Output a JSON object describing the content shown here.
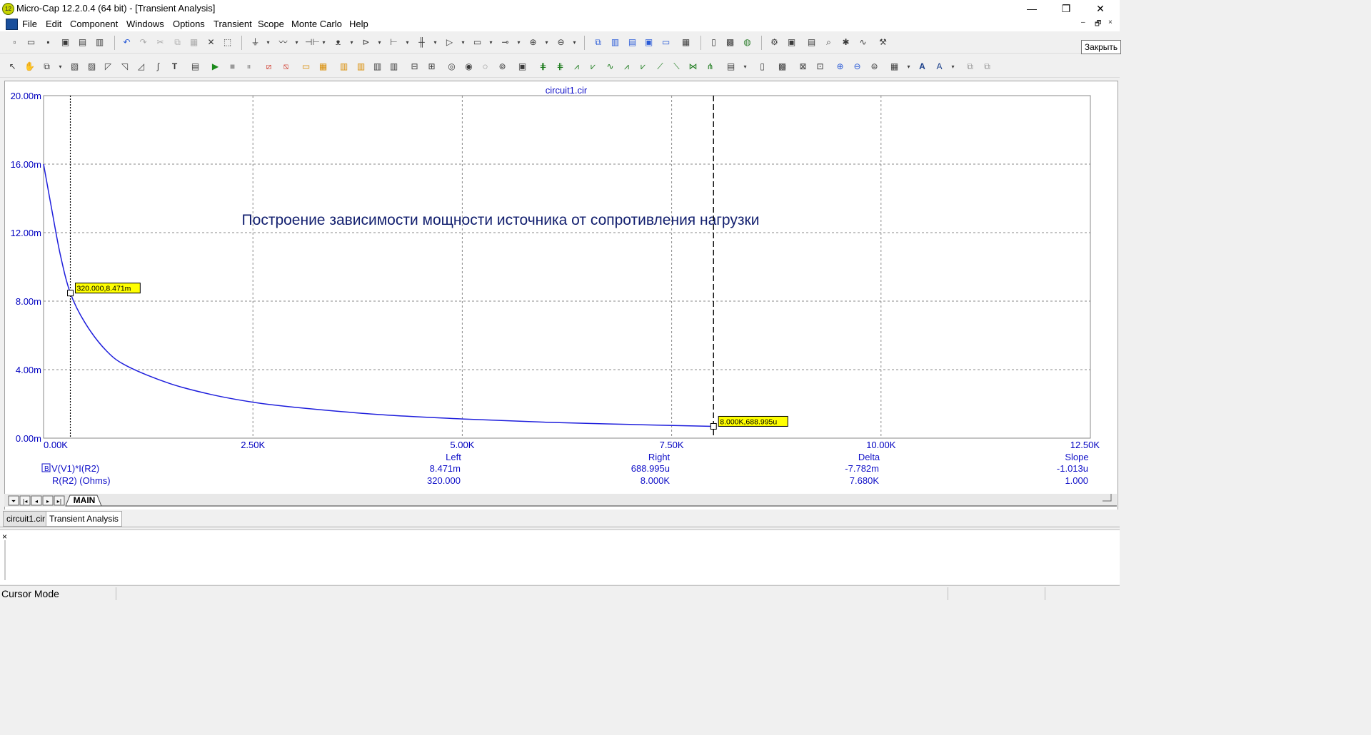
{
  "window": {
    "title": "Micro-Cap 12.2.0.4 (64 bit) - [Transient Analysis]",
    "controls": {
      "minimize": "—",
      "restore": "❐",
      "close": "✕"
    }
  },
  "menu": {
    "items": [
      "File",
      "Edit",
      "Component",
      "Windows",
      "Options",
      "Transient",
      "Scope",
      "Monte Carlo",
      "Help"
    ],
    "mdi": {
      "minimize": "–",
      "restore": "🗗",
      "close": "×"
    }
  },
  "tooltip": "Закрыть",
  "plot": {
    "title": "circuit1.cir",
    "annotation": "Построение зависимости мощности источника от сопротивления нагрузки",
    "curve_color": "#1e1edc",
    "axis_color": "#0000c0",
    "cursor_left_label": "320.000,8.471m",
    "cursor_right_label": "8.000K,688.995u",
    "readout": {
      "headers": [
        "Left",
        "Right",
        "Delta",
        "Slope"
      ],
      "rows": [
        {
          "name": "V(V1)*I(R2)",
          "values": [
            "8.471m",
            "688.995u",
            "-7.782m",
            "-1.013u"
          ]
        },
        {
          "name": "R(R2) (Ohms)",
          "values": [
            "320.000",
            "8.000K",
            "7.680K",
            "1.000"
          ]
        }
      ]
    }
  },
  "chart_data": {
    "type": "line",
    "title": "circuit1.cir",
    "xlabel": "R(R2) (Ohms)",
    "ylabel": "V(V1)*I(R2)",
    "xlim": [
      0,
      12500
    ],
    "ylim": [
      0,
      0.02
    ],
    "x_ticks": [
      "0.00K",
      "2.50K",
      "5.00K",
      "7.50K",
      "10.00K",
      "12.50K"
    ],
    "y_ticks": [
      "0.00m",
      "4.00m",
      "8.00m",
      "12.00m",
      "16.00m",
      "20.00m"
    ],
    "grid": true,
    "series": [
      {
        "name": "V(V1)*I(R2)",
        "x": [
          0,
          100,
          200,
          320,
          500,
          750,
          1000,
          1500,
          2000,
          2500,
          3000,
          4000,
          5000,
          6000,
          7000,
          8000
        ],
        "values": [
          0.016,
          0.0133,
          0.0107,
          0.008471,
          0.0067,
          0.0051,
          0.0042,
          0.0032,
          0.00255,
          0.0021,
          0.0018,
          0.00138,
          0.00112,
          0.00093,
          0.0008,
          0.000689
        ]
      }
    ],
    "cursors": [
      {
        "x": 320,
        "y": 0.008471
      },
      {
        "x": 8000,
        "y": 0.000688995
      }
    ]
  },
  "sheet_tabs": {
    "nav": [
      "⏷",
      "|◂",
      "◂",
      "▸",
      "▸|"
    ],
    "active": "MAIN"
  },
  "doc_tabs": [
    "circuit1.cir",
    "Transient Analysis"
  ],
  "output_close": "×",
  "status": {
    "mode": "Cursor Mode"
  }
}
